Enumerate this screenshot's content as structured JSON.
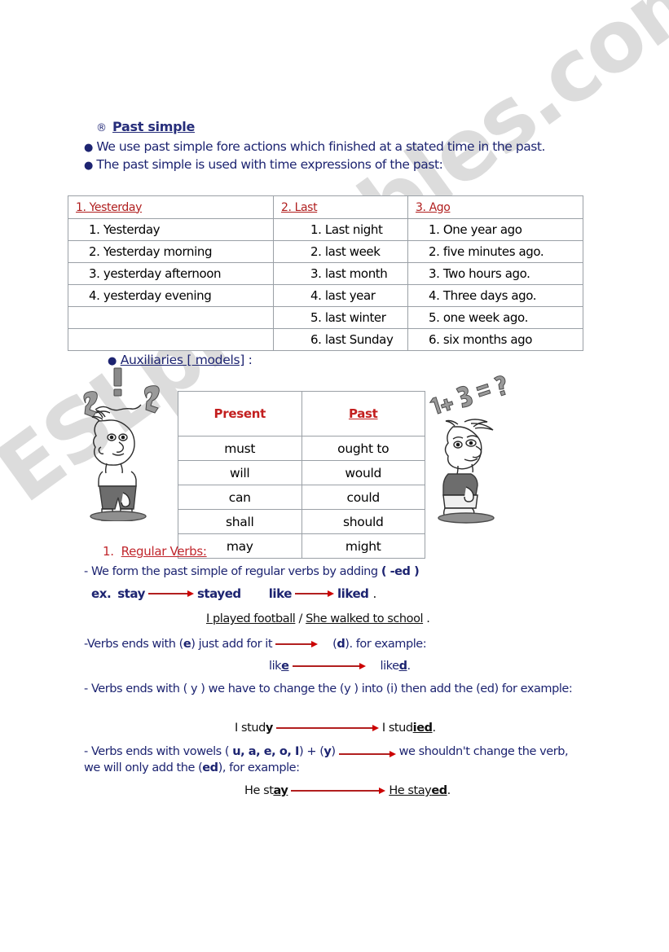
{
  "page": {
    "watermark": "ESLprintables.com"
  },
  "header": {
    "at_symbol": "®",
    "title": "Past simple",
    "intro_line_1": "We use past simple fore actions which finished at a stated time in the past.",
    "intro_line_2": "The past simple is used with time expressions of the past:",
    "bullet_glyph": "●"
  },
  "time_table": {
    "headers": [
      "1. Yesterday",
      "2. Last",
      "3. Ago"
    ],
    "columns": [
      [
        "1.  Yesterday",
        "2.  Yesterday morning",
        "3.  yesterday afternoon",
        "4.  yesterday evening",
        "",
        ""
      ],
      [
        "1.  Last night",
        "2.  last week",
        "3.  last month",
        "4.  last year",
        "5.  last winter",
        "6.  last Sunday"
      ],
      [
        "1.  One year ago",
        "2.  five minutes ago.",
        "3.  Two hours ago.",
        "4.  Three days ago.",
        "5.  one week ago.",
        "6.  six months ago"
      ]
    ]
  },
  "auxiliaries": {
    "heading_bullet": "●",
    "heading_underlined": "Auxiliaries  [ models]",
    "heading_tail": " :",
    "table": {
      "headers": [
        "Present",
        "Past"
      ],
      "rows": [
        [
          "must",
          "ought to"
        ],
        [
          "will",
          "would"
        ],
        [
          "can",
          "could"
        ],
        [
          "shall",
          "should"
        ],
        [
          "may",
          "might"
        ]
      ]
    }
  },
  "cartoons": {
    "left": {
      "name": "confused-man-question-marks",
      "marks": "? ! ?"
    },
    "right": {
      "name": "thinking-man-math-problem",
      "marks": "1 + 3 = ?"
    }
  },
  "regular_verbs": {
    "number": "1.",
    "heading": "Regular Verbs:",
    "rule_ed_a": "- We form the past simple of regular verbs by adding ",
    "rule_ed_b": "( -ed )",
    "example_prefix": "ex.",
    "example_1_from": "stay",
    "example_1_to": "stayed",
    "example_2_from": "like",
    "example_2_to": "liked",
    "example_2_tail": ".",
    "sentence_1": "I played football",
    "sentence_sep": " / ",
    "sentence_2": "She walked to school",
    "sentence_tail": " .",
    "rule_e_a": "-Verbs ends with (",
    "rule_e_letter": "e",
    "rule_e_b": ") just add for it",
    "rule_e_c": "(",
    "rule_e_letter2": "d",
    "rule_e_d": "). for example:",
    "ex_e_from_stem": "lik",
    "ex_e_from_letter": "e",
    "ex_e_to_stem": "like",
    "ex_e_to_letter": "d",
    "ex_e_tail": ".",
    "rule_y": "- Verbs ends with ( y ) we have to change the (y ) into (i) then add the (ed) for example:",
    "ex_y_from_stem": "I stud",
    "ex_y_from_letter": "y",
    "ex_y_to_stem": "I stud",
    "ex_y_to_letter": "ied",
    "ex_y_tail": ".",
    "rule_vowel_a": "- Verbs ends with vowels ( ",
    "rule_vowel_letters": "u, a, e, o, I",
    "rule_vowel_b": ") + (",
    "rule_vowel_y": "y",
    "rule_vowel_c": ")",
    "rule_vowel_d": "we shouldn't change the verb, we will only add the (",
    "rule_vowel_ed": "ed",
    "rule_vowel_e": "), for example:",
    "ex_v_from_stem": "He st",
    "ex_v_from_letter": "ay",
    "ex_v_to_stem": "He stay",
    "ex_v_to_letter": "ed",
    "ex_v_tail": "."
  }
}
